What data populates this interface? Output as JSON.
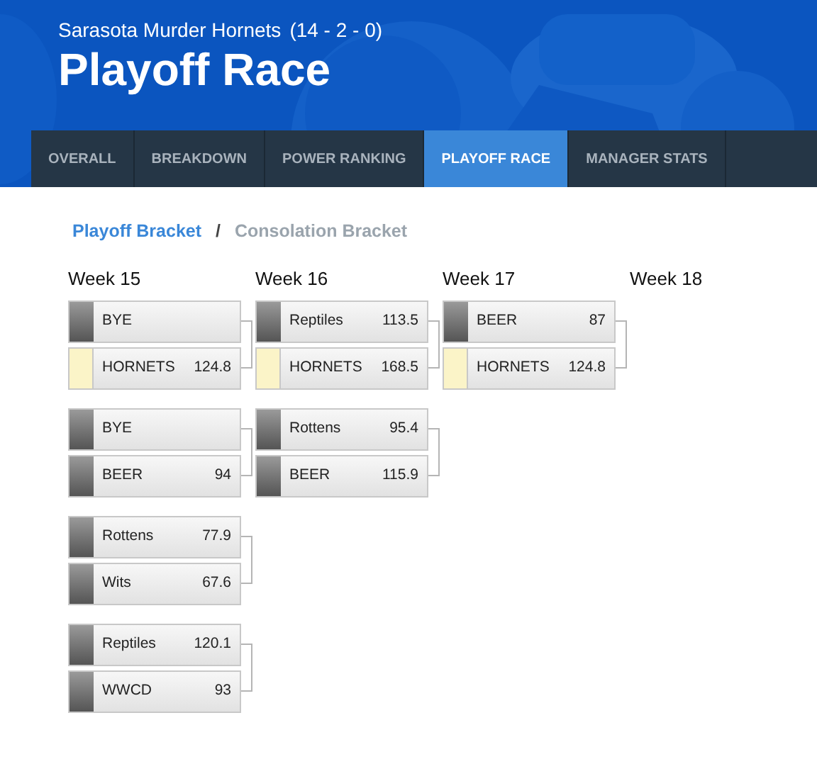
{
  "header": {
    "team": "Sarasota Murder Hornets",
    "record": "(14 - 2 - 0)",
    "title": "Playoff Race"
  },
  "tabs": [
    {
      "label": "OVERALL",
      "selected": false
    },
    {
      "label": "BREAKDOWN",
      "selected": false
    },
    {
      "label": "POWER RANKING",
      "selected": false
    },
    {
      "label": "PLAYOFF RACE",
      "selected": true
    },
    {
      "label": "MANAGER STATS",
      "selected": false
    }
  ],
  "breadcrumb": [
    {
      "label": "Playoff Bracket",
      "selected": true
    },
    {
      "label": "Consolation Bracket",
      "selected": false
    }
  ],
  "breadcrumb_separator": "/",
  "weeks": [
    {
      "label": "Week 15",
      "matchups": [
        [
          {
            "name": "BYE",
            "mine": false
          },
          {
            "name": "HORNETS",
            "score": "124.8",
            "mine": true
          }
        ],
        [
          {
            "name": "BYE",
            "mine": false
          },
          {
            "name": "BEER",
            "score": "94",
            "mine": false
          }
        ],
        [
          {
            "name": "Rottens",
            "score": "77.9",
            "mine": false
          },
          {
            "name": "Wits",
            "score": "67.6",
            "mine": false
          }
        ],
        [
          {
            "name": "Reptiles",
            "score": "120.1",
            "mine": false
          },
          {
            "name": "WWCD",
            "score": "93",
            "mine": false
          }
        ]
      ]
    },
    {
      "label": "Week 16",
      "matchups": [
        [
          {
            "name": "Reptiles",
            "score": "113.5",
            "mine": false
          },
          {
            "name": "HORNETS",
            "score": "168.5",
            "mine": true
          }
        ],
        [
          {
            "name": "Rottens",
            "score": "95.4",
            "mine": false
          },
          {
            "name": "BEER",
            "score": "115.9",
            "mine": false
          }
        ]
      ]
    },
    {
      "label": "Week 17",
      "matchups": [
        [
          {
            "name": "BEER",
            "score": "87",
            "mine": false
          },
          {
            "name": "HORNETS",
            "score": "124.8",
            "mine": true
          }
        ]
      ]
    },
    {
      "label": "Week 18"
    }
  ]
}
